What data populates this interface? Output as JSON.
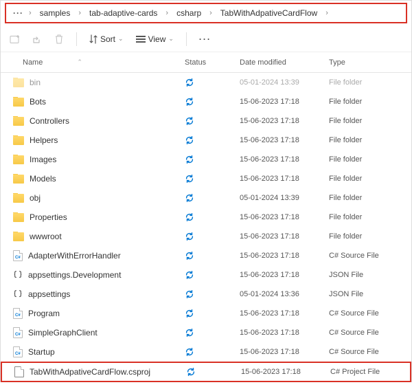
{
  "breadcrumb": {
    "ellipsis": "···",
    "items": [
      "samples",
      "tab-adaptive-cards",
      "csharp",
      "TabWithAdpativeCardFlow"
    ]
  },
  "toolbar": {
    "sort": "Sort",
    "view": "View",
    "more": "···"
  },
  "headers": {
    "name": "Name",
    "status": "Status",
    "date": "Date modified",
    "type": "Type"
  },
  "rows": [
    {
      "icon": "folder",
      "name": "bin",
      "date": "05-01-2024 13:39",
      "type": "File folder",
      "dim": true
    },
    {
      "icon": "folder",
      "name": "Bots",
      "date": "15-06-2023 17:18",
      "type": "File folder"
    },
    {
      "icon": "folder",
      "name": "Controllers",
      "date": "15-06-2023 17:18",
      "type": "File folder"
    },
    {
      "icon": "folder",
      "name": "Helpers",
      "date": "15-06-2023 17:18",
      "type": "File folder"
    },
    {
      "icon": "folder",
      "name": "Images",
      "date": "15-06-2023 17:18",
      "type": "File folder"
    },
    {
      "icon": "folder",
      "name": "Models",
      "date": "15-06-2023 17:18",
      "type": "File folder"
    },
    {
      "icon": "folder",
      "name": "obj",
      "date": "05-01-2024 13:39",
      "type": "File folder"
    },
    {
      "icon": "folder",
      "name": "Properties",
      "date": "15-06-2023 17:18",
      "type": "File folder"
    },
    {
      "icon": "folder",
      "name": "wwwroot",
      "date": "15-06-2023 17:18",
      "type": "File folder"
    },
    {
      "icon": "cs",
      "name": "AdapterWithErrorHandler",
      "date": "15-06-2023 17:18",
      "type": "C# Source File"
    },
    {
      "icon": "json",
      "name": "appsettings.Development",
      "date": "15-06-2023 17:18",
      "type": "JSON File"
    },
    {
      "icon": "json",
      "name": "appsettings",
      "date": "05-01-2024 13:36",
      "type": "JSON File"
    },
    {
      "icon": "cs",
      "name": "Program",
      "date": "15-06-2023 17:18",
      "type": "C# Source File"
    },
    {
      "icon": "cs",
      "name": "SimpleGraphClient",
      "date": "15-06-2023 17:18",
      "type": "C# Source File"
    },
    {
      "icon": "cs",
      "name": "Startup",
      "date": "15-06-2023 17:18",
      "type": "C# Source File"
    },
    {
      "icon": "proj",
      "name": "TabWithAdpativeCardFlow.csproj",
      "date": "15-06-2023 17:18",
      "type": "C# Project File",
      "highlight": true
    }
  ]
}
